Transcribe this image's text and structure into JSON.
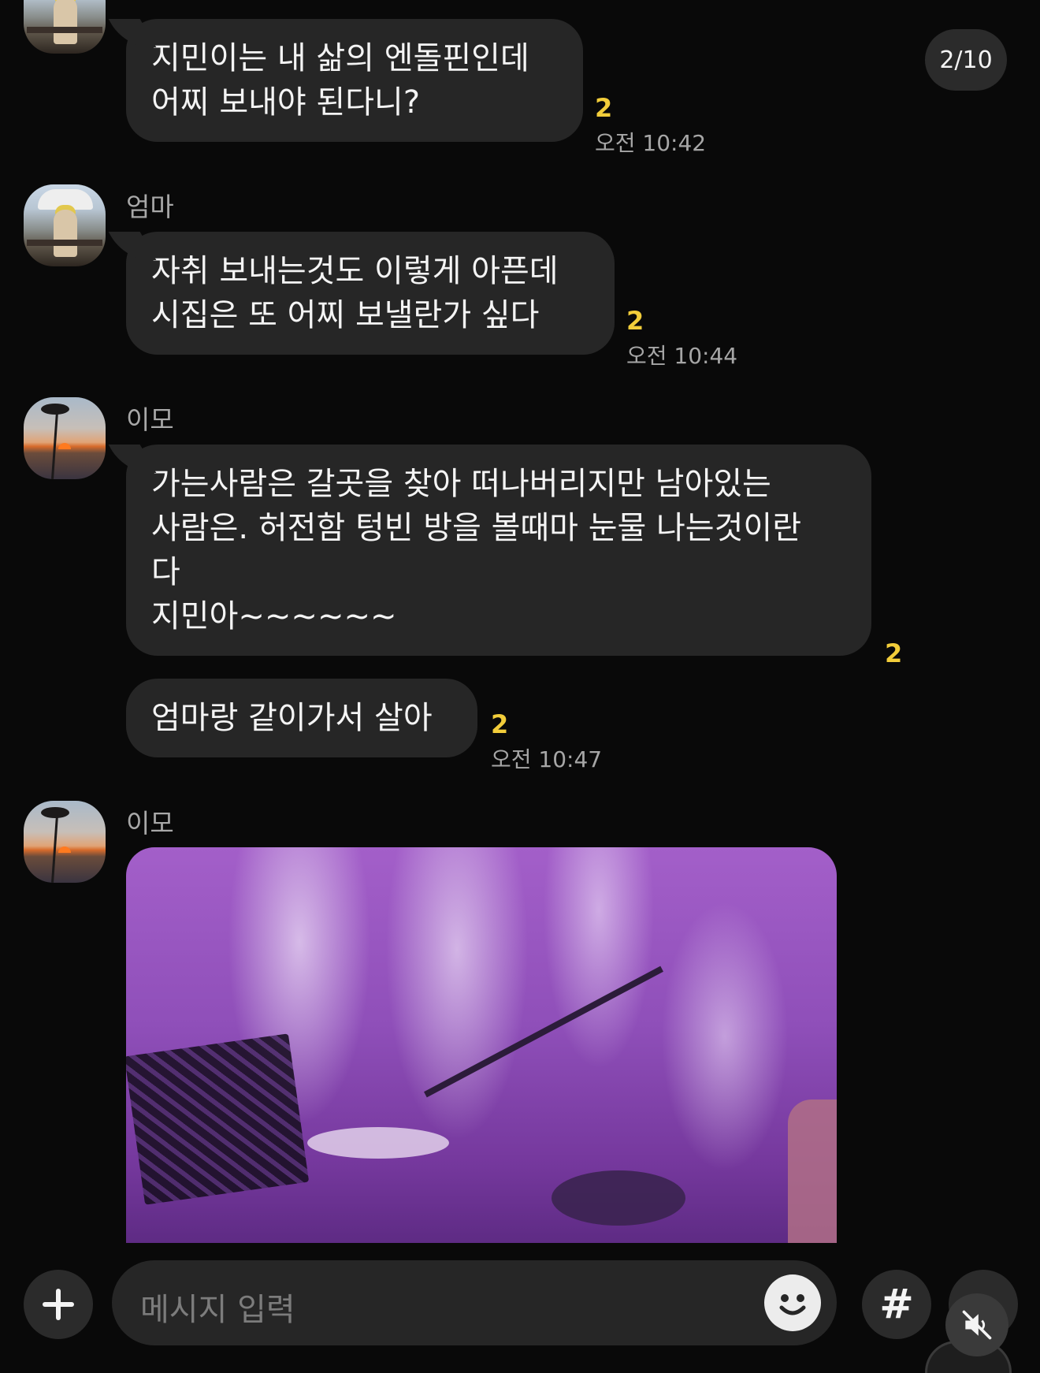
{
  "page_counter": "2/10",
  "messages": [
    {
      "text": "지민이는 내 삶의 엔돌핀인데\n어찌 보내야 된다니?",
      "unread": "2",
      "time": "오전 10:42"
    },
    {
      "sender": "엄마",
      "text": "자취 보내는것도 이렇게 아픈데\n시집은 또 어찌 보낼란가 싶다",
      "unread": "2",
      "time": "오전 10:44"
    },
    {
      "sender": "이모",
      "text": "가는사람은 갈곳을 찾아 떠나버리지만 남아있는\n사람은. 허전함 텅빈 방을 볼때마 눈물 나는것이란\n다\n지민아~~~~~~",
      "unread": "2"
    },
    {
      "text": "엄마랑 같이가서 살아",
      "unread": "2",
      "time": "오전 10:47"
    },
    {
      "sender": "이모",
      "type": "photo"
    }
  ],
  "input": {
    "placeholder": "메시지 입력",
    "hash_label": "#"
  },
  "icons": [
    "plus-icon",
    "emoji-icon",
    "hash-icon",
    "more-icon",
    "mute-icon",
    "caption-icon"
  ]
}
